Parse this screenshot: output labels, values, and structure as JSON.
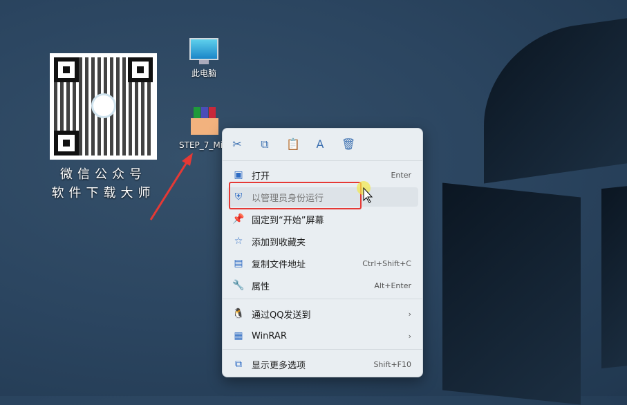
{
  "desktop": {
    "icons": [
      {
        "label": "此电脑",
        "icon": "monitor-icon"
      },
      {
        "label": "STEP_7_Mi...",
        "icon": "winrar-archive-icon"
      }
    ]
  },
  "qr": {
    "line1": "微信公众号",
    "line2": "软件下载大师"
  },
  "menu": {
    "toolbar": [
      {
        "icon": "cut-icon",
        "glyph": "✂"
      },
      {
        "icon": "copy-icon",
        "glyph": "⧉"
      },
      {
        "icon": "paste-icon",
        "glyph": "📋"
      },
      {
        "icon": "rename-icon",
        "glyph": "A"
      },
      {
        "icon": "delete-icon",
        "glyph": "🗑"
      }
    ],
    "items": [
      {
        "label": "打开",
        "shortcut": "Enter",
        "icon": "open-icon",
        "glyph": "▣"
      },
      {
        "label": "以管理员身份运行",
        "shortcut": "",
        "icon": "shield-icon",
        "glyph": "⛨"
      },
      {
        "label": "固定到“开始”屏幕",
        "shortcut": "",
        "icon": "pin-icon",
        "glyph": "📌"
      },
      {
        "label": "添加到收藏夹",
        "shortcut": "",
        "icon": "star-icon",
        "glyph": "☆"
      },
      {
        "label": "复制文件地址",
        "shortcut": "Ctrl+Shift+C",
        "icon": "copy-path-icon",
        "glyph": "▤"
      },
      {
        "label": "属性",
        "shortcut": "Alt+Enter",
        "icon": "wrench-icon",
        "glyph": "🔧"
      },
      {
        "label": "通过QQ发送到",
        "shortcut": "›",
        "icon": "qq-icon",
        "glyph": "🐧"
      },
      {
        "label": "WinRAR",
        "shortcut": "›",
        "icon": "winrar-icon",
        "glyph": "▦"
      },
      {
        "label": "显示更多选项",
        "shortcut": "Shift+F10",
        "icon": "more-options-icon",
        "glyph": "⧉"
      }
    ]
  },
  "colors": {
    "highlight_box": "#e53935",
    "accent": "#2d6bc4"
  }
}
